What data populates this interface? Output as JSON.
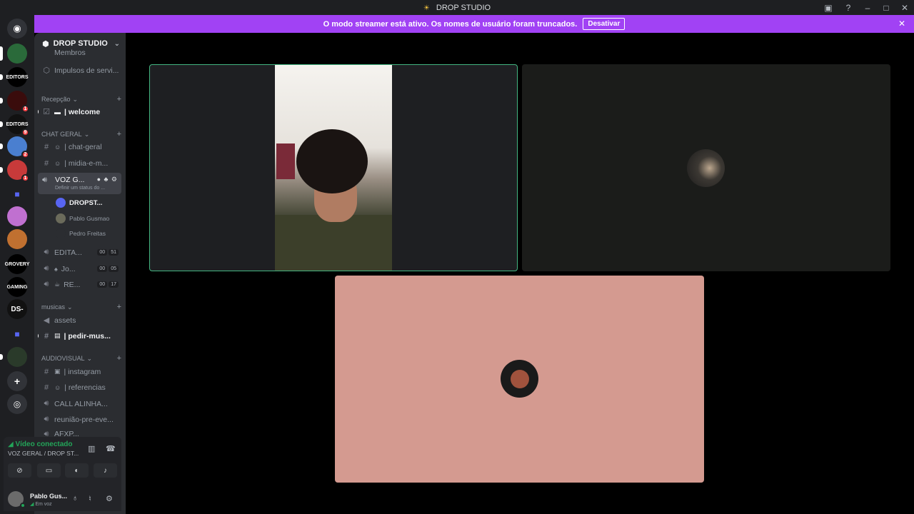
{
  "window": {
    "title": "DROP STUDIO"
  },
  "streamer_bar": {
    "message": "O modo streamer está ativo. Os nomes de usuário foram truncados.",
    "button": "Desativar"
  },
  "rail": [
    {
      "label": "EDITORS",
      "badge": ""
    },
    {
      "label": "",
      "badge": "1"
    },
    {
      "label": "EDITORS",
      "badge": "9"
    },
    {
      "label": "",
      "badge": "2"
    },
    {
      "label": "",
      "badge": "1"
    },
    {
      "label": "",
      "badge": ""
    },
    {
      "label": "",
      "badge": ""
    },
    {
      "label": "",
      "badge": ""
    },
    {
      "label": "GROVERY",
      "badge": ""
    },
    {
      "label": "GAMING",
      "badge": ""
    },
    {
      "label": "DS-",
      "badge": ""
    }
  ],
  "server": {
    "name": "DROP STUDIO",
    "partial_top": "Membros",
    "boosts": "Impulsos de servi..."
  },
  "categories": {
    "recepcao": "Recepção",
    "chat_geral": "CHAT GERAL",
    "musicas": "musicas",
    "audiovisual": "AUDIOVISUAL"
  },
  "channels": {
    "welcome": "| welcome",
    "chat_geral": "| chat-geral",
    "midia": "| midia-e-m...",
    "voz_geral": "VOZ G...",
    "voz_status": "Definir um status do ...",
    "editar": "EDITA...",
    "jo": "Jo...",
    "re": "RE...",
    "assets": "assets",
    "pedir_musica": "| pedir-mus...",
    "instagram": "| instagram",
    "referencias": "| referencias",
    "call_alinha": "CALL ALINHA...",
    "reuniao": "reunião-pre-eve...",
    "partial_bottom": "AFXP..."
  },
  "counts": {
    "editar": [
      "00",
      "51"
    ],
    "jo": [
      "00",
      "05"
    ],
    "re": [
      "00",
      "17"
    ]
  },
  "voice_users": [
    "DROPST...",
    "Pablo Gusmao",
    "Pedro Freitas"
  ],
  "voice_panel": {
    "status": "Vídeo conectado",
    "channel": "VOZ GERAL / DROP ST..."
  },
  "user": {
    "name": "Pablo Gus...",
    "status": "Em voz"
  },
  "colors": {
    "streamer_purple": "#a142f4",
    "speaking_green": "#43b581",
    "tile3_bg": "#d49a90"
  }
}
